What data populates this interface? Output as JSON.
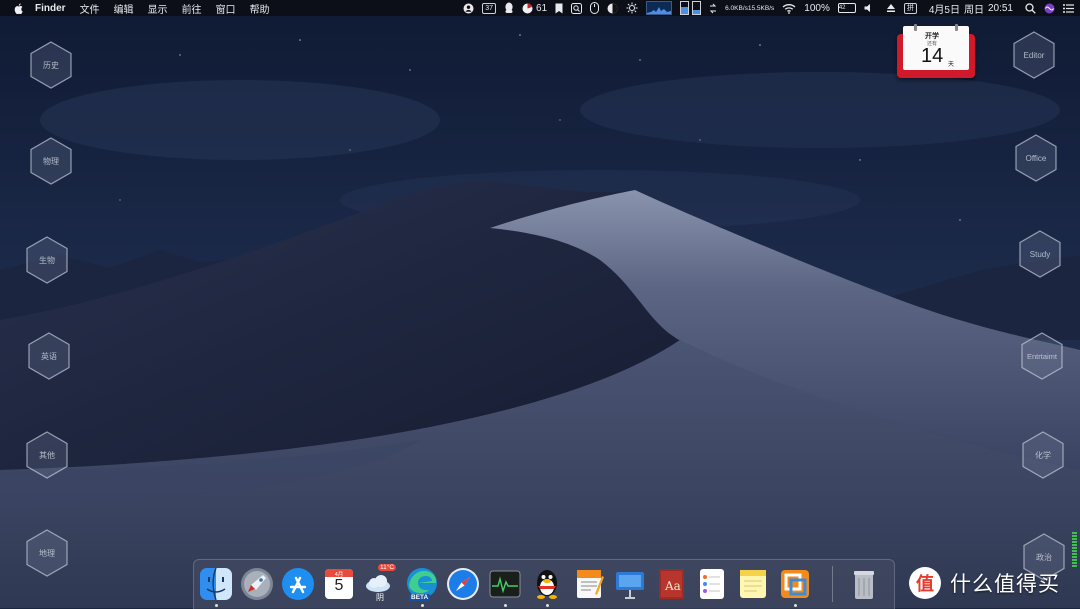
{
  "menubar": {
    "app_name": "Finder",
    "menus": [
      "文件",
      "编辑",
      "显示",
      "前往",
      "窗口",
      "帮助"
    ],
    "status": {
      "badge_37": "37",
      "count_61": "61",
      "net_up": "6.0KB/s",
      "net_down": "15.5KB/s",
      "battery_percent": "100%",
      "battery_badge": "42",
      "date": "4月5日",
      "weekday": "周日",
      "time": "20:51",
      "input_method": "拼"
    }
  },
  "left_widgets": [
    "历史",
    "物理",
    "生物",
    "英语",
    "其他",
    "地理"
  ],
  "right_widgets": [
    "Editor",
    "Office",
    "Study",
    "Entrtaimt",
    "化学",
    "政治"
  ],
  "calendar_widget": {
    "title": "开学",
    "subtitle": "还有",
    "number": "14",
    "unit": "天"
  },
  "dock": {
    "calendar_month": "4月",
    "calendar_day": "5",
    "weather_temp": "11°C",
    "weather_text": "阴",
    "edge_badge": "BETA",
    "apps": [
      "finder",
      "launchpad",
      "app-store",
      "calendar",
      "weather",
      "edge-beta",
      "safari",
      "activity-monitor",
      "qq",
      "pages",
      "keynote",
      "dictionary",
      "reminders",
      "notes",
      "vmware-fusion",
      "trash"
    ]
  },
  "watermark": {
    "text": "什么值得买"
  },
  "colors": {
    "menubar_bg": "#0c0e16",
    "accent_red": "#d0192a",
    "dock_bg": "#464e64"
  }
}
